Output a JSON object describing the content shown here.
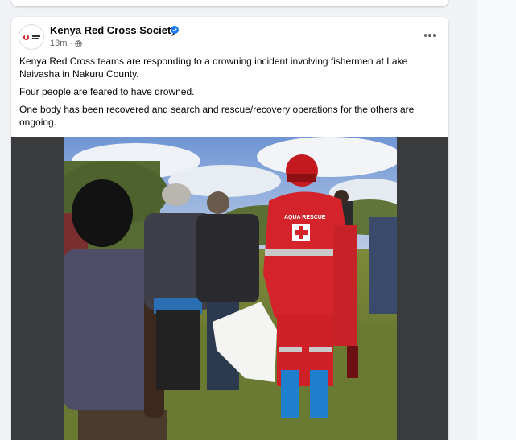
{
  "post": {
    "page_name": "Kenya Red Cross Society",
    "verified": true,
    "timestamp": "13m",
    "separator": "·",
    "privacy_icon": "globe-icon",
    "more_icon": "more-options-icon",
    "paragraphs": [
      "Kenya Red Cross teams are responding to a drowning incident involving fishermen at Lake Naivasha in Nakuru County.",
      "Four people are feared to have drowned.",
      "One body has been recovered and search and rescue/recovery operations for the others are ongoing."
    ],
    "photo": {
      "jacket_text": "AQUA RESCUE"
    }
  },
  "colors": {
    "accent_blue": "#1877f2",
    "red_cross": "#e41e26",
    "page_bg": "#f0f2f5"
  }
}
